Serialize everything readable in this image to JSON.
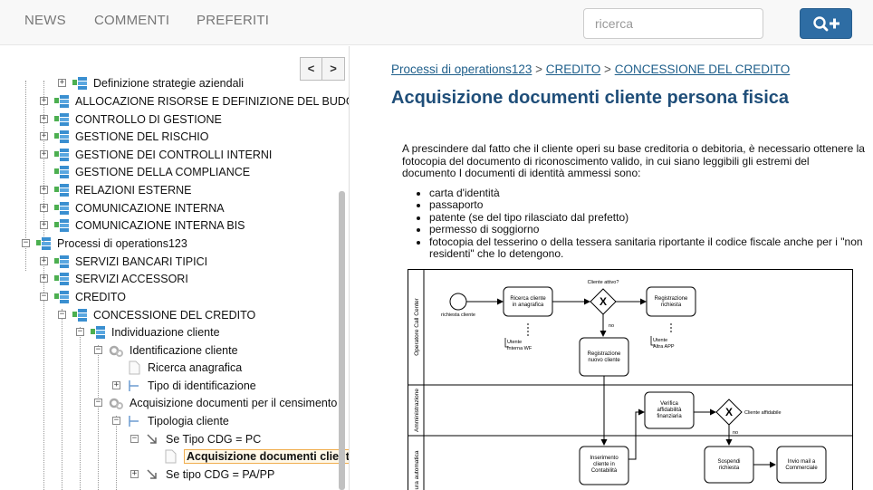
{
  "nav": {
    "news": "NEWS",
    "comments": "COMMENTI",
    "favorites": "PREFERITI",
    "search_placeholder": "ricerca"
  },
  "pager": {
    "prev": "<",
    "next": ">"
  },
  "tree": {
    "items": [
      {
        "label": "Definizione strategie aziendali"
      },
      {
        "label": "ALLOCAZIONE RISORSE E DEFINIZIONE DEL BUDGET"
      },
      {
        "label": "CONTROLLO DI GESTIONE"
      },
      {
        "label": "GESTIONE DEL RISCHIO"
      },
      {
        "label": "GESTIONE DEI CONTROLLI INTERNI"
      },
      {
        "label": "GESTIONE DELLA COMPLIANCE"
      },
      {
        "label": "RELAZIONI ESTERNE"
      },
      {
        "label": "COMUNICAZIONE INTERNA"
      },
      {
        "label": "COMUNICAZIONE INTERNA BIS"
      },
      {
        "label": "Processi di operations123"
      },
      {
        "label": "SERVIZI BANCARI TIPICI"
      },
      {
        "label": "SERVIZI ACCESSORI"
      },
      {
        "label": "CREDITO"
      },
      {
        "label": "CONCESSIONE DEL CREDITO"
      },
      {
        "label": "Individuazione cliente"
      },
      {
        "label": "Identificazione cliente"
      },
      {
        "label": "Ricerca anagrafica"
      },
      {
        "label": "Tipo di identificazione"
      },
      {
        "label": "Acquisizione documenti per il censimento"
      },
      {
        "label": "Tipologia cliente"
      },
      {
        "label": "Se Tipo CDG = PC"
      },
      {
        "label": "Acquisizione documenti clienti"
      },
      {
        "label": "Se tipo CDG = PA/PP"
      }
    ]
  },
  "breadcrumb": {
    "items": [
      "Processi di operations123",
      "CREDITO",
      "CONCESSIONE DEL CREDITO"
    ],
    "separator": ">"
  },
  "page": {
    "title": "Acquisizione documenti cliente persona fisica",
    "intro": "A prescindere dal fatto che il cliente operi su base creditoria o debitoria, è necessario ottenere la fotocopia del documento di riconoscimento valido, in cui siano leggibili gli estremi del documento I documenti di identità ammessi sono:",
    "list": [
      "carta d'identità",
      "passaporto",
      "patente (se del tipo rilasciato dal prefetto)",
      "permesso di soggiorno",
      "fotocopia del tesserino o della tessera sanitaria riportante il codice fiscale anche per i \"non residenti\" che lo detengono."
    ]
  },
  "diagram": {
    "lanes": [
      "Operatore Call Center",
      "Amministrazione",
      "ura automatica"
    ],
    "start_label": "richiesta cliente",
    "tasks": {
      "ricerca": [
        "Ricerca cliente",
        "in anagrafica"
      ],
      "registrazione_richiesta": [
        "Registrazione",
        "richiesta"
      ],
      "registrazione_cliente": [
        "Registrazione",
        "nuovo cliente"
      ],
      "verifica": [
        "Verifica",
        "affidabilità",
        "finanziaria"
      ],
      "inserimento": [
        "Inserimento",
        "cliente in",
        "Contabilità"
      ],
      "sospendi": [
        "Sospendi",
        "richiesta"
      ],
      "invio": [
        "Invio mail a",
        "Commerciale"
      ]
    },
    "gateways": {
      "attivo": "Cliente  attivo?",
      "affidabile": "Cliente affidabile"
    },
    "no_label": "no",
    "actors": {
      "interna": [
        "Utente",
        "Interna WF"
      ],
      "altra": [
        "Utente",
        "Altra APP"
      ]
    }
  }
}
